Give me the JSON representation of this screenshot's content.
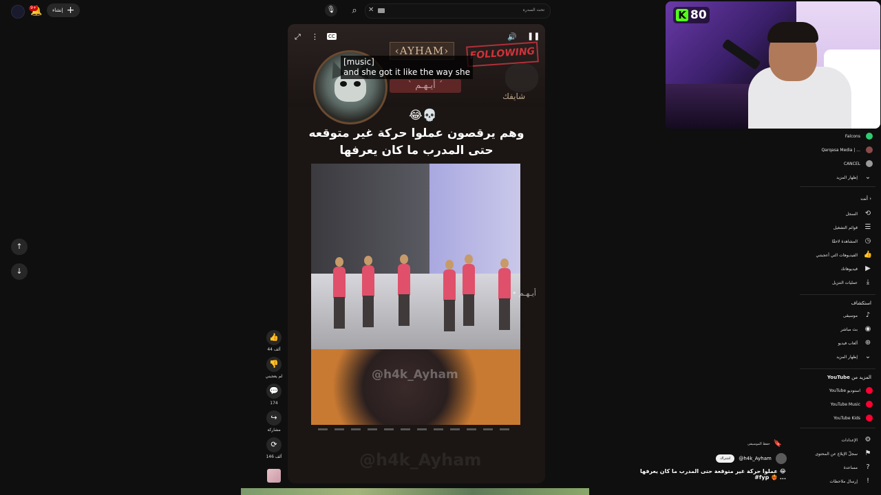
{
  "header": {
    "notif_badge": "9+",
    "create_label": "إنشاء",
    "search_placeholder": "تحت السدره"
  },
  "stream_overlay": {
    "kick_viewers": "80"
  },
  "short": {
    "caption_line1": "[music]",
    "caption_line2": "and she got it like the way she",
    "name_plate": "‹AYHAM›",
    "following": "FOLLOWING",
    "arabic_tag": "` أيـهـم ´",
    "shayif": "شايفك",
    "emojis": "😂💀",
    "title_line1": "وهم يرقصون عملوا حركة غير متوقعه",
    "title_line2": "حتى المدرب ما كان يعرفها",
    "watermark": "@h4k_Ayham",
    "side_watermark": "• أيـهـم"
  },
  "actions": {
    "likes": "44 ألف",
    "dislike": "لم يعجبني",
    "comments": "174",
    "share": "مشاركة",
    "remix": "146 ألف"
  },
  "sidebar": {
    "subscriptions": [
      {
        "label": "Falcons",
        "color": "#2ecc71"
      },
      {
        "label": "Qarqasa Media | ...",
        "color": "#8a4a4a"
      },
      {
        "label": "CANCEL",
        "color": "#9a9a9a"
      }
    ],
    "show_more_1": "إظهار المزيد",
    "you_heading": "أنت",
    "you_items": [
      {
        "label": "السجل",
        "icon": "history-icon",
        "glyph": "⟲"
      },
      {
        "label": "قوائم التشغيل",
        "icon": "playlist-icon",
        "glyph": "☰"
      },
      {
        "label": "المشاهدة لاحقًا",
        "icon": "clock-icon",
        "glyph": "◷"
      },
      {
        "label": "الفيديوهات التي أعجبتني",
        "icon": "thumb-up-icon",
        "glyph": "👍"
      },
      {
        "label": "فيديوهاتك",
        "icon": "your-videos-icon",
        "glyph": "▶"
      },
      {
        "label": "عمليات التنزيل",
        "icon": "download-icon",
        "glyph": "⤓"
      }
    ],
    "explore_heading": "استكشاف",
    "explore_items": [
      {
        "label": "موسيقى",
        "icon": "music-icon",
        "glyph": "♪"
      },
      {
        "label": "بث مباشر",
        "icon": "live-icon",
        "glyph": "◉"
      },
      {
        "label": "ألعاب فيديو",
        "icon": "gaming-icon",
        "glyph": "⊕"
      },
      {
        "label": "إظهار المزيد",
        "icon": "chevron-down-icon",
        "glyph": "⌄"
      }
    ],
    "more_heading_brand": "YouTube",
    "more_heading_prefix": "المزيد من",
    "more_items": [
      {
        "label": "YouTube استوديو"
      },
      {
        "label": "YouTube Music"
      },
      {
        "label": "YouTube Kids"
      }
    ],
    "settings_items": [
      {
        "label": "الإعدادات",
        "icon": "settings-icon",
        "glyph": "⚙"
      },
      {
        "label": "سجلّ الإبلاغ عن المحتوى",
        "icon": "flag-icon",
        "glyph": "⚑"
      },
      {
        "label": "مساعدة",
        "icon": "help-icon",
        "glyph": "?"
      },
      {
        "label": "إرسال ملاحظات",
        "icon": "feedback-icon",
        "glyph": "!"
      }
    ]
  },
  "channel": {
    "save_sound": "حفظ الموسيقى",
    "subscribe": "اشتراك",
    "handle": "@h4k_Ayham",
    "description": "عملوا حركة غير متوقعة حتى المدرب ما كان يعرفها 😂 #fyp ❤️‍🔥 ..."
  }
}
